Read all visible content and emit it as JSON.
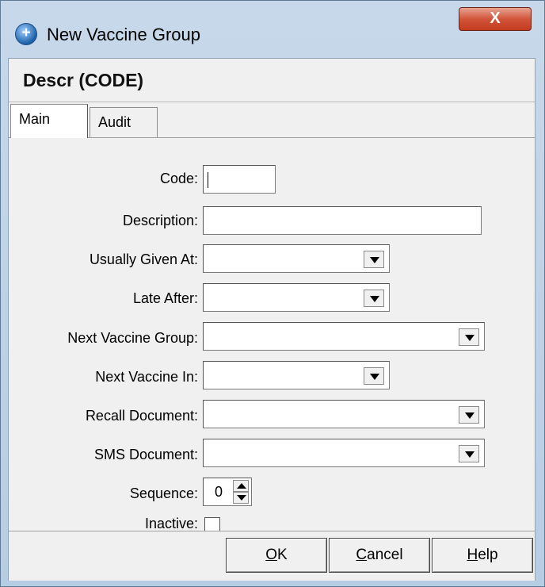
{
  "window": {
    "title": "New Vaccine Group",
    "close_label": "X"
  },
  "header": {
    "title": "Descr (CODE)"
  },
  "tabs": [
    {
      "label": "Main"
    },
    {
      "label": "Audit"
    }
  ],
  "form": {
    "code_label": "Code:",
    "code_value": "",
    "description_label": "Description:",
    "description_value": "",
    "usually_given_at_label": "Usually Given At:",
    "late_after_label": "Late After:",
    "next_vaccine_group_label": "Next Vaccine Group:",
    "next_vaccine_in_label": "Next Vaccine In:",
    "recall_document_label": "Recall Document:",
    "sms_document_label": "SMS Document:",
    "sequence_label": "Sequence:",
    "sequence_value": "0",
    "inactive_label": "Inactive:",
    "inactive_checked": false
  },
  "buttons": {
    "ok": {
      "mnemonic": "O",
      "rest": "K"
    },
    "cancel": {
      "mnemonic": "C",
      "rest": "ancel"
    },
    "help": {
      "mnemonic": "H",
      "rest": "elp"
    }
  },
  "icons": {
    "app": "add-plus-circle-icon",
    "close": "close-icon"
  },
  "colors": {
    "titlebar": "#c7d8ea",
    "close_button": "#d2553a",
    "client_bg": "#f0f0f0"
  }
}
